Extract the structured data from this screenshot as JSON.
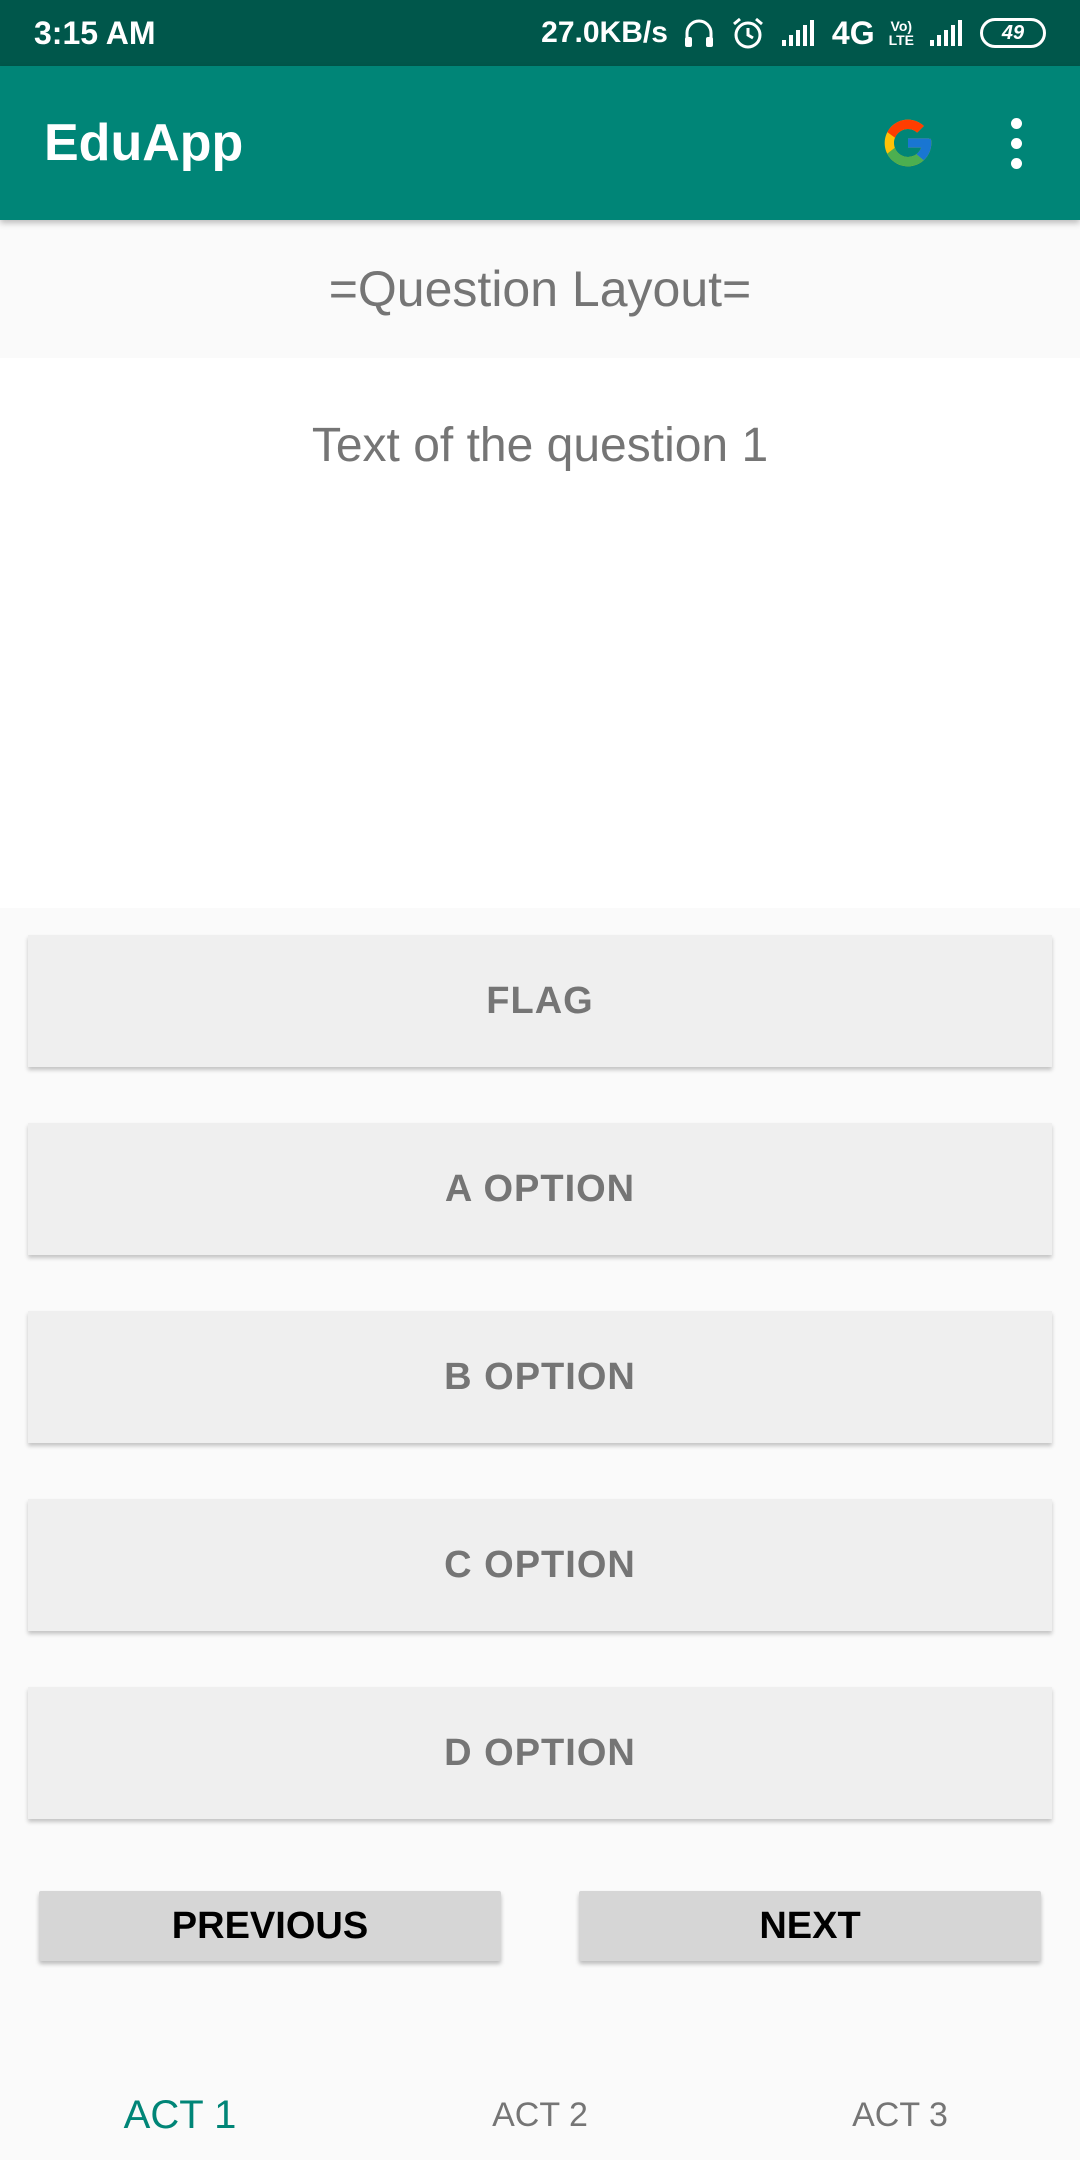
{
  "status_bar": {
    "time": "3:15 AM",
    "net_speed": "27.0KB/s",
    "network_4g": "4G",
    "volte_top": "Vo)",
    "volte_bottom": "LTE",
    "battery": "49",
    "icons": [
      "headset-icon",
      "alarm-icon",
      "signal-icon",
      "signal-icon"
    ]
  },
  "app_bar": {
    "title": "EduApp",
    "actions": [
      "google-icon",
      "more-vert-icon"
    ],
    "color": "#008577"
  },
  "layout_label": "=Question Layout=",
  "question": {
    "text": "Text of the question 1"
  },
  "buttons": {
    "flag": "FLAG",
    "option_a": "A OPTION",
    "option_b": "B OPTION",
    "option_c": "C OPTION",
    "option_d": "D OPTION",
    "previous": "PREVIOUS",
    "next": "NEXT"
  },
  "tabs": [
    {
      "label": "ACT 1",
      "active": true
    },
    {
      "label": "ACT 2",
      "active": false
    },
    {
      "label": "ACT 3",
      "active": false
    }
  ],
  "colors": {
    "status_bar": "#00574b",
    "primary": "#008577",
    "button_bg": "#efefef",
    "nav_button_bg": "#d6d6d6",
    "muted_text": "#757575"
  }
}
